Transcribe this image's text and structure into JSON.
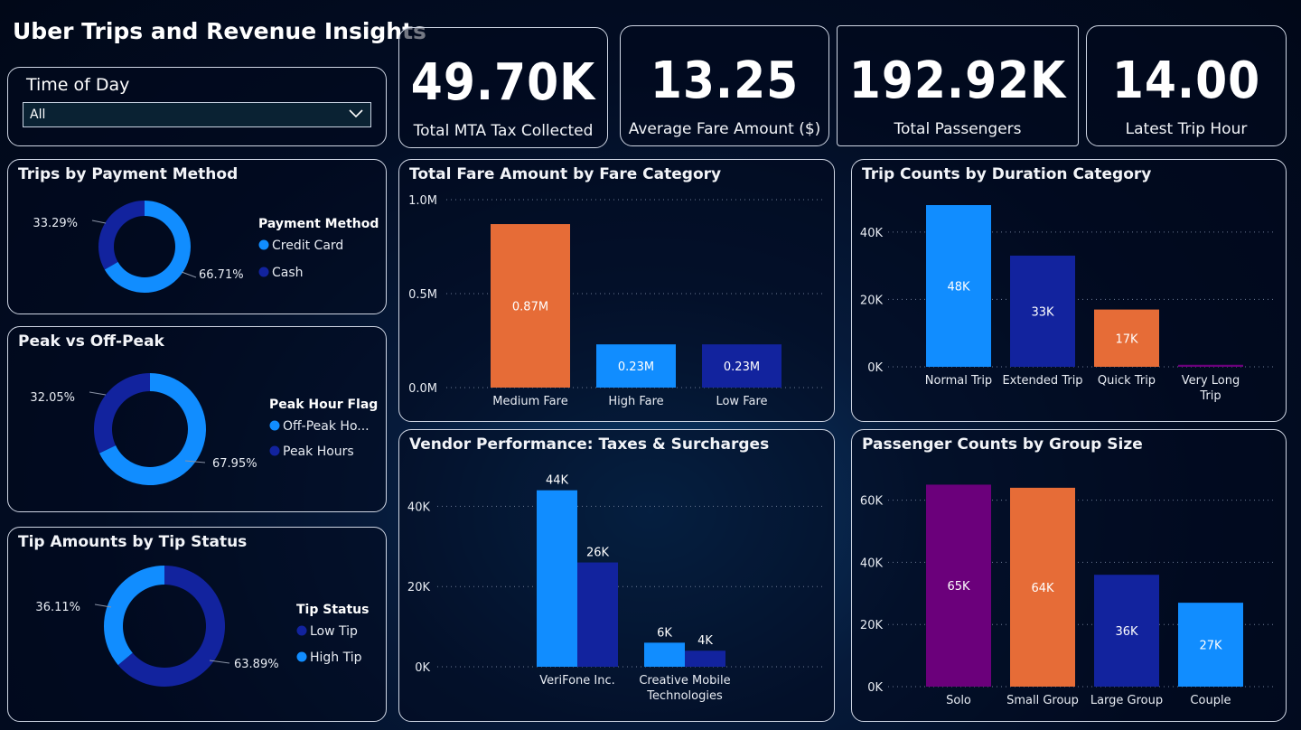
{
  "title": "Uber Trips and Revenue Insights",
  "slicer": {
    "label": "Time of Day",
    "value": "All"
  },
  "kpis": [
    {
      "value": "49.70K",
      "label": "Total MTA Tax Collected"
    },
    {
      "value": "13.25",
      "label": "Average Fare Amount ($)"
    },
    {
      "value": "192.92K",
      "label": "Total Passengers"
    },
    {
      "value": "14.00",
      "label": "Latest Trip Hour"
    }
  ],
  "colors": {
    "light_blue": "#118dff",
    "navy": "#12239e",
    "orange": "#e66c37",
    "purple": "#6b007b"
  },
  "chart_data": [
    {
      "id": "payment",
      "type": "pie",
      "title": "Trips by Payment Method",
      "legend_title": "Payment Method",
      "slices": [
        {
          "label": "Credit Card",
          "value": 66.71,
          "display": "66.71%",
          "color": "#118dff"
        },
        {
          "label": "Cash",
          "value": 33.29,
          "display": "33.29%",
          "color": "#12239e"
        }
      ]
    },
    {
      "id": "peak",
      "type": "pie",
      "title": "Peak vs Off-Peak",
      "legend_title": "Peak Hour Flag",
      "slices": [
        {
          "label": "Off-Peak Ho...",
          "value": 67.95,
          "display": "67.95%",
          "color": "#118dff"
        },
        {
          "label": "Peak Hours",
          "value": 32.05,
          "display": "32.05%",
          "color": "#12239e"
        }
      ]
    },
    {
      "id": "tip",
      "type": "pie",
      "title": "Tip Amounts by Tip Status",
      "legend_title": "Tip Status",
      "slices": [
        {
          "label": "Low Tip",
          "value": 63.89,
          "display": "63.89%",
          "color": "#12239e"
        },
        {
          "label": "High Tip",
          "value": 36.11,
          "display": "36.11%",
          "color": "#118dff"
        }
      ]
    },
    {
      "id": "fare",
      "type": "bar",
      "title": "Total Fare Amount by Fare Category",
      "categories": [
        "Medium Fare",
        "High Fare",
        "Low Fare"
      ],
      "values": [
        870000,
        230000,
        230000
      ],
      "labels": [
        "0.87M",
        "0.23M",
        "0.23M"
      ],
      "colors": [
        "#e66c37",
        "#118dff",
        "#12239e"
      ],
      "ylim": [
        0,
        1000000
      ],
      "ticks": [
        0,
        500000,
        1000000
      ],
      "tick_labels": [
        "0.0M",
        "0.5M",
        "1.0M"
      ]
    },
    {
      "id": "duration",
      "type": "bar",
      "title": "Trip Counts by Duration Category",
      "categories": [
        "Normal Trip",
        "Extended Trip",
        "Quick Trip",
        "Very Long Trip"
      ],
      "values": [
        48000,
        33000,
        17000,
        600
      ],
      "labels": [
        "48K",
        "33K",
        "17K",
        ""
      ],
      "colors": [
        "#118dff",
        "#12239e",
        "#e66c37",
        "#6b007b"
      ],
      "ylim": [
        0,
        48000
      ],
      "ticks": [
        0,
        20000,
        40000
      ],
      "tick_labels": [
        "0K",
        "20K",
        "40K"
      ]
    },
    {
      "id": "vendor",
      "type": "bar",
      "title": "Vendor Performance: Taxes & Surcharges",
      "categories": [
        "VeriFone Inc.",
        "Creative Mobile Technologies"
      ],
      "series": [
        {
          "values": [
            44000,
            6000
          ],
          "labels": [
            "44K",
            "6K"
          ],
          "color": "#118dff"
        },
        {
          "values": [
            26000,
            4000
          ],
          "labels": [
            "26K",
            "4K"
          ],
          "color": "#12239e"
        }
      ],
      "ylim": [
        0,
        50000
      ],
      "ticks": [
        0,
        20000,
        40000
      ],
      "tick_labels": [
        "0K",
        "20K",
        "40K"
      ]
    },
    {
      "id": "group",
      "type": "bar",
      "title": "Passenger Counts by Group Size",
      "categories": [
        "Solo",
        "Small Group",
        "Large Group",
        "Couple"
      ],
      "values": [
        65000,
        64000,
        36000,
        27000
      ],
      "labels": [
        "65K",
        "64K",
        "36K",
        "27K"
      ],
      "colors": [
        "#6b007b",
        "#e66c37",
        "#12239e",
        "#118dff"
      ],
      "ylim": [
        0,
        66000
      ],
      "ticks": [
        0,
        20000,
        40000,
        60000
      ],
      "tick_labels": [
        "0K",
        "20K",
        "40K",
        "60K"
      ]
    }
  ]
}
